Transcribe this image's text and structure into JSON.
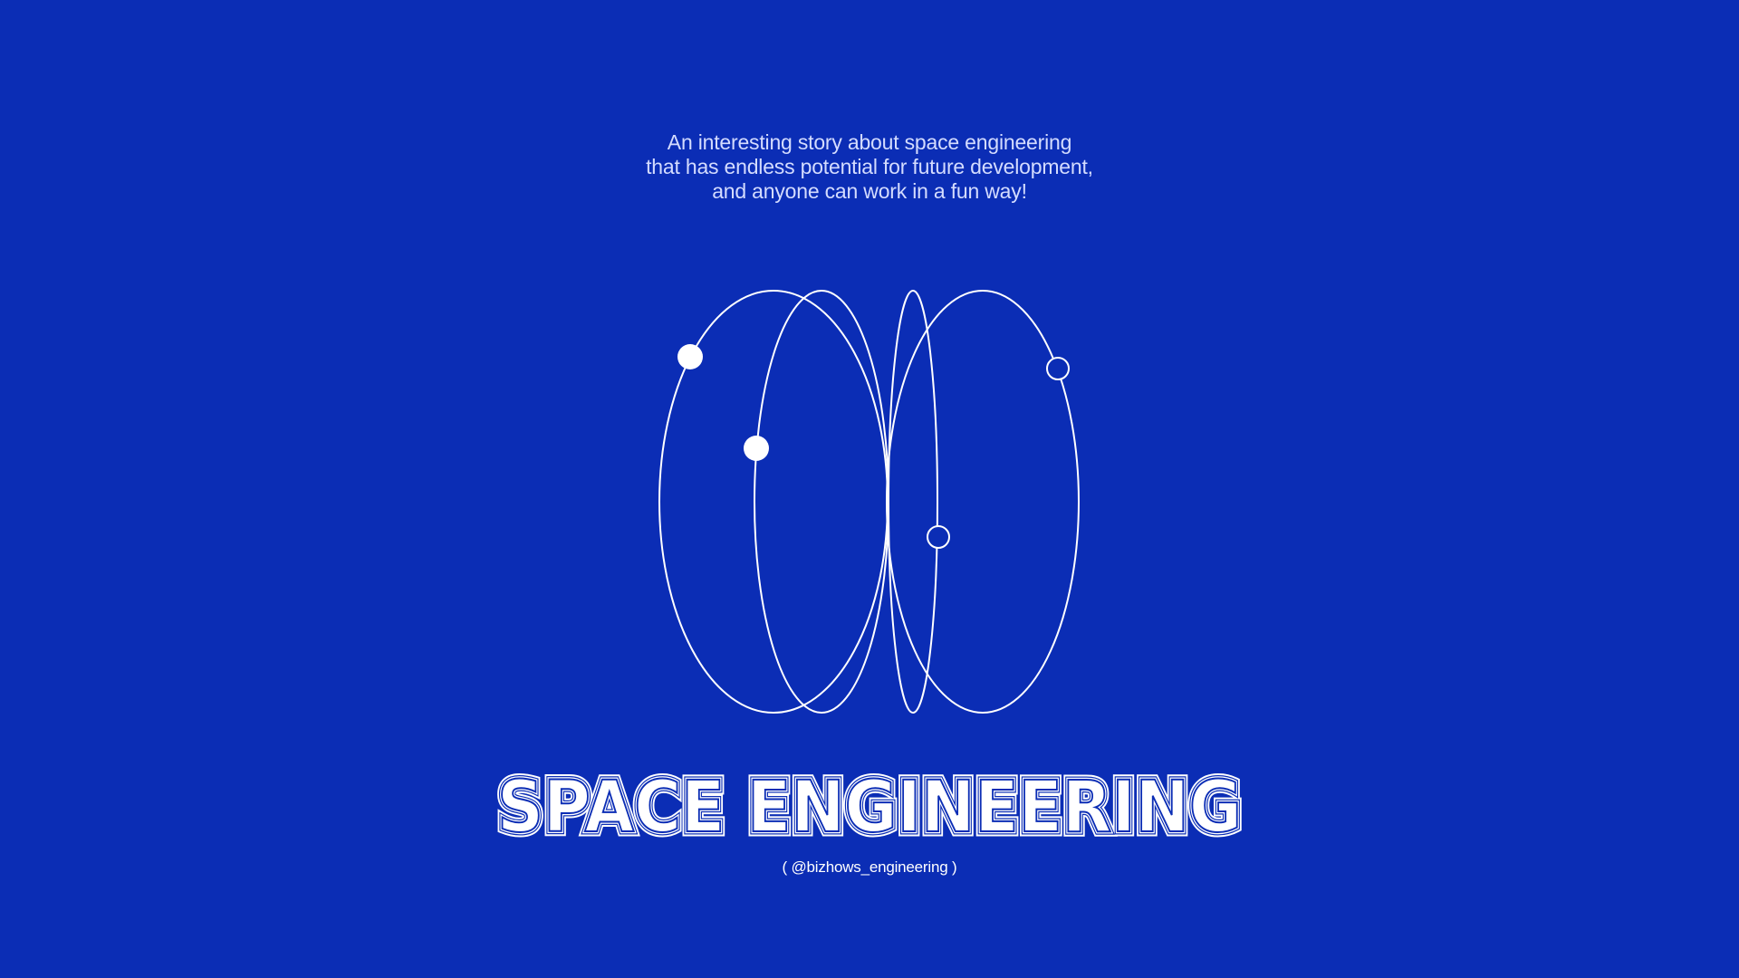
{
  "intro": {
    "line1": "An interesting story about space engineering",
    "line2": "that has endless potential for future development,",
    "line3": "and anyone can work in a fun way!"
  },
  "graphic": {
    "icon": "orbit-ellipses-icon"
  },
  "title": {
    "text": "SPACE ENGINEERING"
  },
  "handle": {
    "text": "( @bizhows_engineering )"
  },
  "colors": {
    "background": "#0b2db5",
    "foreground": "#ffffff",
    "intro_text": "#d4dcff"
  }
}
